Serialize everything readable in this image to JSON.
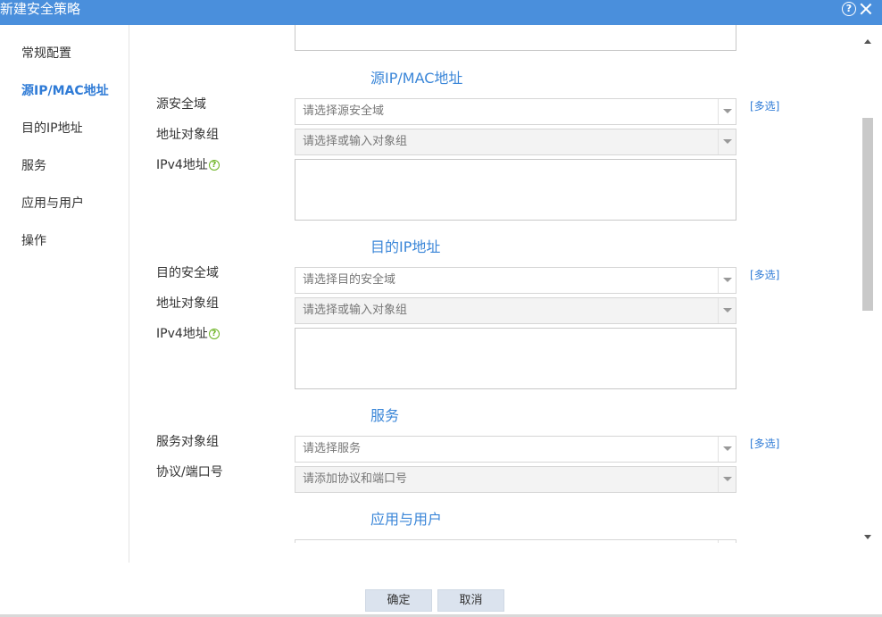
{
  "window": {
    "title": "新建安全策略"
  },
  "sidebar": {
    "items": [
      {
        "label": "常规配置"
      },
      {
        "label": "源IP/MAC地址"
      },
      {
        "label": "目的IP地址"
      },
      {
        "label": "服务"
      },
      {
        "label": "应用与用户"
      },
      {
        "label": "操作"
      }
    ]
  },
  "source": {
    "title": "源IP/MAC地址",
    "zone_label": "源安全域",
    "zone_placeholder": "请选择源安全域",
    "multi": "[多选]",
    "addr_group_label": "地址对象组",
    "addr_group_placeholder": "请选择或输入对象组",
    "ipv4_label": "IPv4地址"
  },
  "destination": {
    "title": "目的IP地址",
    "zone_label": "目的安全域",
    "zone_placeholder": "请选择目的安全域",
    "multi": "[多选]",
    "addr_group_label": "地址对象组",
    "addr_group_placeholder": "请选择或输入对象组",
    "ipv4_label": "IPv4地址"
  },
  "service": {
    "title": "服务",
    "group_label": "服务对象组",
    "group_placeholder": "请选择服务",
    "multi": "[多选]",
    "protocol_label": "协议/端口号",
    "protocol_placeholder": "请添加协议和端口号"
  },
  "app_user": {
    "title": "应用与用户"
  },
  "footer": {
    "ok": "确定",
    "cancel": "取消"
  },
  "colors": {
    "title_bar": "#4a8fdc",
    "accent": "#2f7bd6",
    "help_icon": "#6bb321"
  }
}
